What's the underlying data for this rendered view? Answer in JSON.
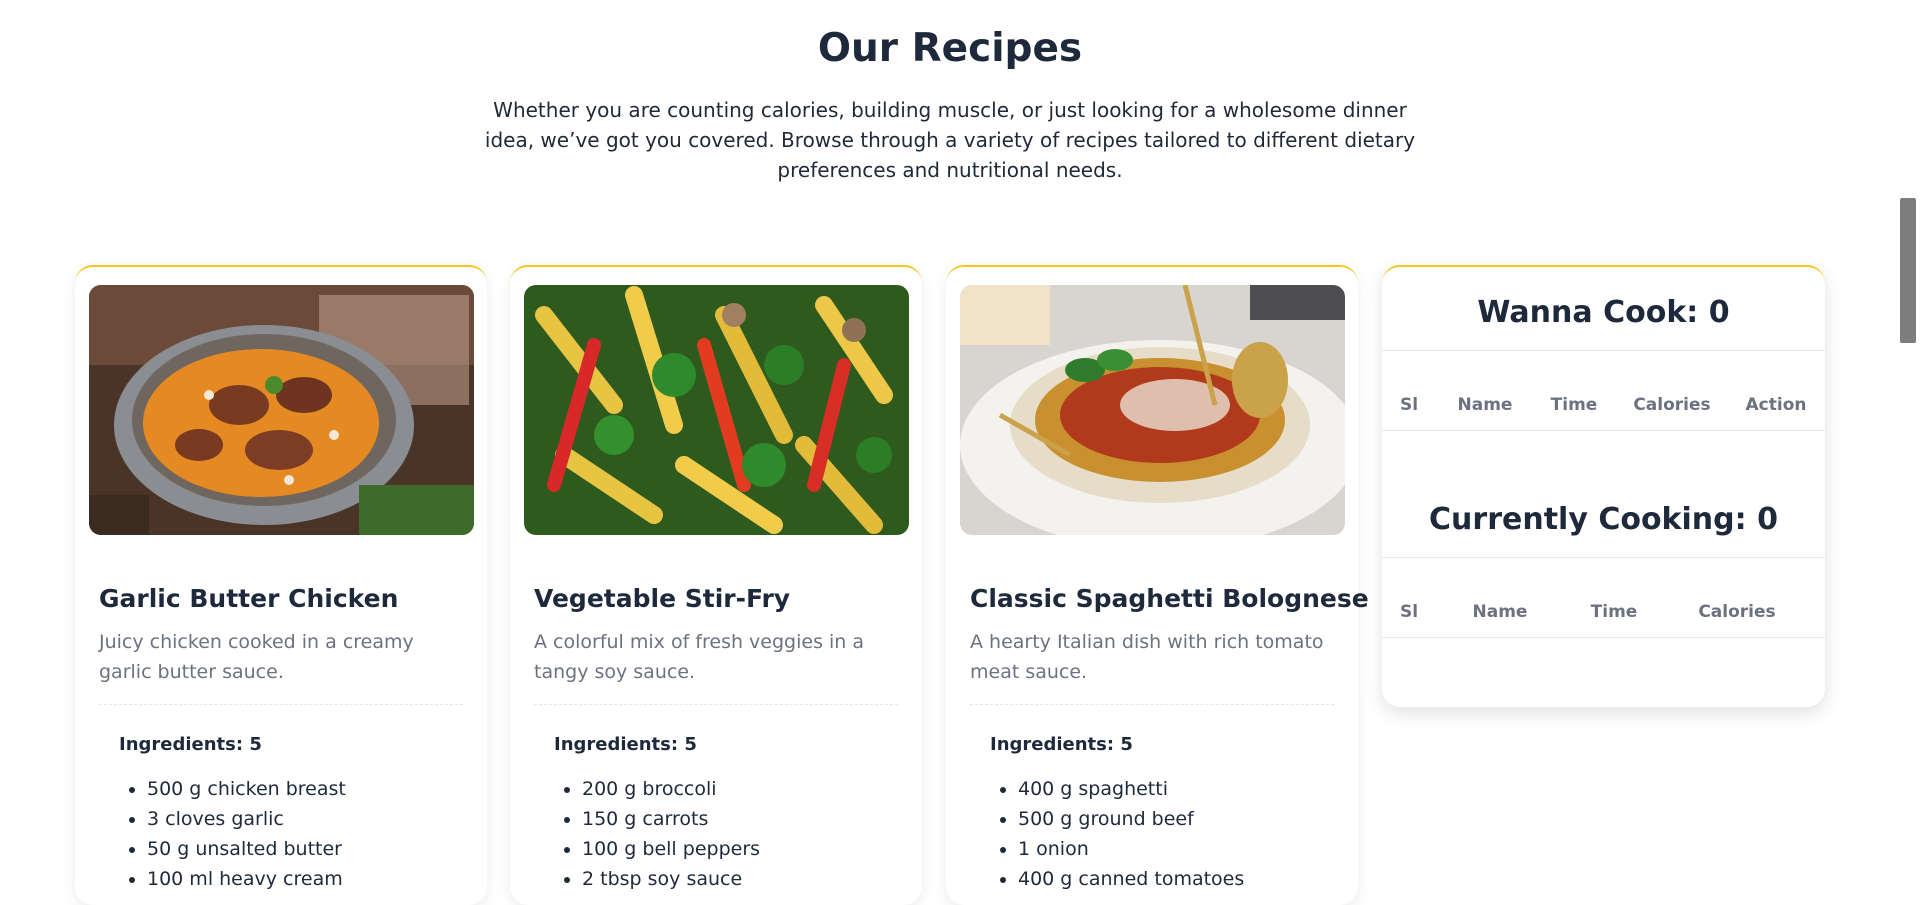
{
  "header": {
    "title": "Our Recipes",
    "intro": "Whether you are counting calories, building muscle, or just looking for a wholesome dinner idea, we’ve got you covered. Browse through a variety of recipes tailored to different dietary preferences and nutritional needs."
  },
  "recipes": [
    {
      "title": "Garlic Butter Chicken",
      "description": "Juicy chicken cooked in a creamy garlic butter sauce.",
      "ingredients_label": "Ingredients: 5",
      "ingredients": [
        "500 g chicken breast",
        "3 cloves garlic",
        "50 g unsalted butter",
        "100 ml heavy cream"
      ]
    },
    {
      "title": "Vegetable Stir-Fry",
      "description": "A colorful mix of fresh veggies in a tangy soy sauce.",
      "ingredients_label": "Ingredients: 5",
      "ingredients": [
        "200 g broccoli",
        "150 g carrots",
        "100 g bell peppers",
        "2 tbsp soy sauce"
      ]
    },
    {
      "title": "Classic Spaghetti Bolognese",
      "description": "A hearty Italian dish with rich tomato meat sauce.",
      "ingredients_label": "Ingredients: 5",
      "ingredients": [
        "400 g spaghetti",
        "500 g ground beef",
        "1 onion",
        "400 g canned tomatoes"
      ]
    }
  ],
  "sidebar": {
    "wanna_cook_title": "Wanna Cook: 0",
    "wanna_cook_columns": [
      "Sl",
      "Name",
      "Time",
      "Calories",
      "Action"
    ],
    "cooking_title": "Currently Cooking: 0",
    "cooking_columns": [
      "Sl",
      "Name",
      "Time",
      "Calories"
    ]
  },
  "colors": {
    "accent": "#f5c518",
    "heading": "#1e2a3b",
    "muted": "#6b7280"
  }
}
